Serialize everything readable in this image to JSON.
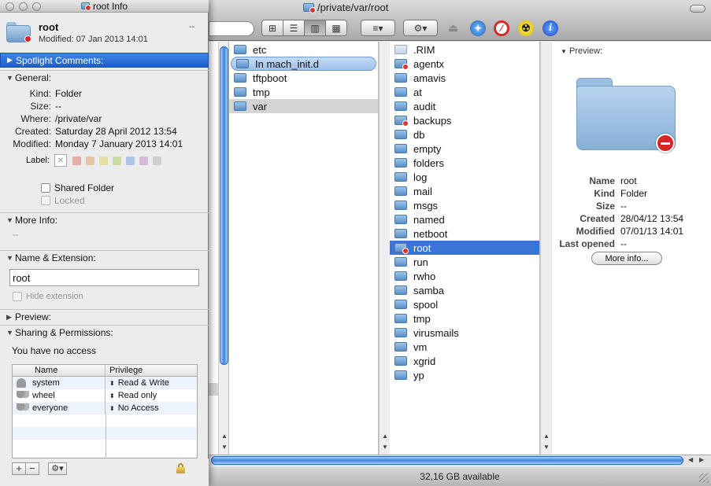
{
  "finder": {
    "title": "/private/var/root",
    "status": "32,16 GB available",
    "toolbar": {
      "view_icons": [
        "⊞",
        "☰",
        "▥",
        "▦"
      ],
      "arrange_icon": "≡▾",
      "action_icon": "⚙▾",
      "eject_icon": "⏏"
    },
    "col1_items": [
      "etc",
      "In mach_init.d",
      "tftpboot",
      "tmp",
      "var"
    ],
    "col2_items": [
      ".RIM",
      "agentx",
      "amavis",
      "at",
      "audit",
      "backups",
      "db",
      "empty",
      "folders",
      "log",
      "mail",
      "msgs",
      "named",
      "netboot",
      "root",
      "run",
      "rwho",
      "samba",
      "spool",
      "tmp",
      "virusmails",
      "vm",
      "xgrid",
      "yp"
    ],
    "preview": {
      "header": "Preview:",
      "rows": [
        {
          "label": "Name",
          "value": "root"
        },
        {
          "label": "Kind",
          "value": "Folder"
        },
        {
          "label": "Size",
          "value": "--"
        },
        {
          "label": "Created",
          "value": "28/04/12 13:54"
        },
        {
          "label": "Modified",
          "value": "07/01/13 14:01"
        },
        {
          "label": "Last opened",
          "value": "--"
        }
      ],
      "more_info_button": "More info..."
    }
  },
  "info": {
    "window_title": "root Info",
    "name": "root",
    "modified_short": "Modified: 07 Jan 2013 14:01",
    "size_short": "--",
    "spotlight_header": "Spotlight Comments:",
    "general_header": "General:",
    "general": [
      {
        "k": "Kind:",
        "v": "Folder"
      },
      {
        "k": "Size:",
        "v": "--"
      },
      {
        "k": "Where:",
        "v": "/private/var"
      },
      {
        "k": "Created:",
        "v": "Saturday 28 April 2012 13:54"
      },
      {
        "k": "Modified:",
        "v": "Monday 7 January 2013 14:01"
      }
    ],
    "label_caption": "Label:",
    "label_colors": [
      "#e07a6c",
      "#e8a663",
      "#e6d36a",
      "#a9d168",
      "#7aa6e3",
      "#bf8fd0",
      "#b5b5b5"
    ],
    "shared_folder": "Shared Folder",
    "locked": "Locked",
    "more_info_header": "More Info:",
    "more_info_value": "--",
    "name_ext_header": "Name & Extension:",
    "name_field": "root",
    "hide_extension": "Hide extension",
    "preview_header": "Preview:",
    "sharing_header": "Sharing & Permissions:",
    "access_text": "You have no access",
    "perm_headers": {
      "name": "Name",
      "privilege": "Privilege"
    },
    "permissions": [
      {
        "name": "system",
        "privilege": "Read & Write"
      },
      {
        "name": "wheel",
        "privilege": "Read only"
      },
      {
        "name": "everyone",
        "privilege": "No Access"
      }
    ]
  }
}
